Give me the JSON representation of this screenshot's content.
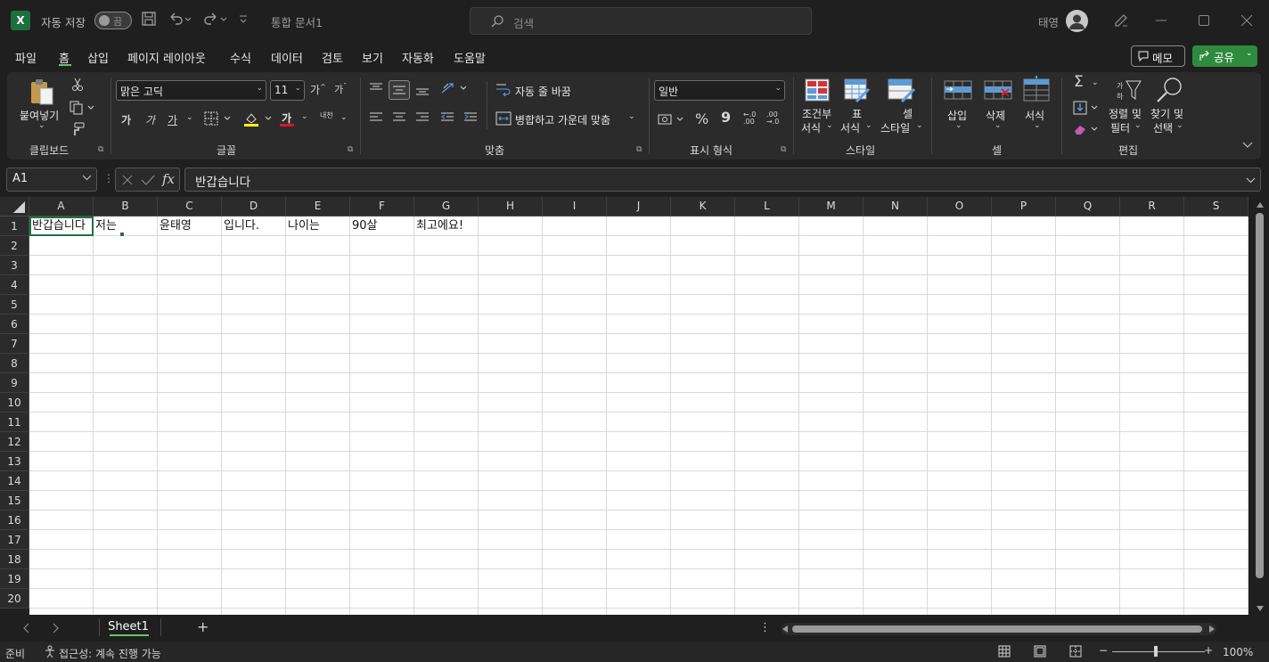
{
  "app": {
    "logo_letter": "X",
    "autosave_label": "자동 저장",
    "autosave_state": "끔",
    "document_title": "통합 문서1",
    "search_placeholder": "검색",
    "user_name": "태영"
  },
  "menu_tabs": [
    "파일",
    "홈",
    "삽입",
    "페이지 레이아웃",
    "수식",
    "데이터",
    "검토",
    "보기",
    "자동화",
    "도움말"
  ],
  "active_tab": "홈",
  "header_buttons": {
    "memo": "메모",
    "share": "공유"
  },
  "ribbon": {
    "clipboard": {
      "paste": "붙여넣기",
      "group": "클립보드"
    },
    "font": {
      "font_name": "맑은 고딕",
      "font_size": "11",
      "bold": "가",
      "italic": "가",
      "underline": "가",
      "font_color_glyph": "가",
      "phonetic": "내천",
      "group": "글꼴"
    },
    "alignment": {
      "wrap_text": "자동 줄 바꿈",
      "merge_center": "병합하고 가운데 맞춤",
      "group": "맞춤"
    },
    "number": {
      "format": "일반",
      "percent": "%",
      "comma": "9",
      "increase_decimal": "←.0 .00",
      "decrease_decimal": ".00 →.0",
      "group": "표시 형식"
    },
    "styles": {
      "conditional_line1": "조건부",
      "conditional_line2": "서식",
      "table_line1": "표",
      "table_line2": "서식",
      "cell_line1": "셀",
      "cell_line2": "스타일",
      "group": "스타일"
    },
    "cells": {
      "insert": "삽입",
      "delete": "삭제",
      "format": "서식",
      "group": "셀"
    },
    "editing": {
      "sort_line1": "정렬 및",
      "sort_line2": "필터",
      "find_line1": "찾기 및",
      "find_line2": "선택",
      "group": "편집"
    }
  },
  "formula_bar": {
    "name_box": "A1",
    "fx": "fx",
    "content": "반갑습니다"
  },
  "grid": {
    "columns": [
      "A",
      "B",
      "C",
      "D",
      "E",
      "F",
      "G",
      "H",
      "I",
      "J",
      "K",
      "L",
      "M",
      "N",
      "O",
      "P",
      "Q",
      "R",
      "S"
    ],
    "rows": [
      "1",
      "2",
      "3",
      "4",
      "5",
      "6",
      "7",
      "8",
      "9",
      "10",
      "11",
      "12",
      "13",
      "14",
      "15",
      "16",
      "17",
      "18",
      "19",
      "20"
    ],
    "row1": [
      "반갑습니다",
      "저는",
      "윤태영",
      "입니다.",
      "나이는",
      "90살",
      "최고에요!"
    ]
  },
  "sheets": {
    "active": "Sheet1",
    "add": "+"
  },
  "status": {
    "ready": "준비",
    "accessibility": "접근성: 계속 진행 가능",
    "zoom": "100%",
    "zoom_minus": "−",
    "zoom_plus": "+"
  },
  "colors": {
    "accent": "#1e7145",
    "share_green": "#2e8b3e",
    "tab_underline": "#6ac46a"
  }
}
